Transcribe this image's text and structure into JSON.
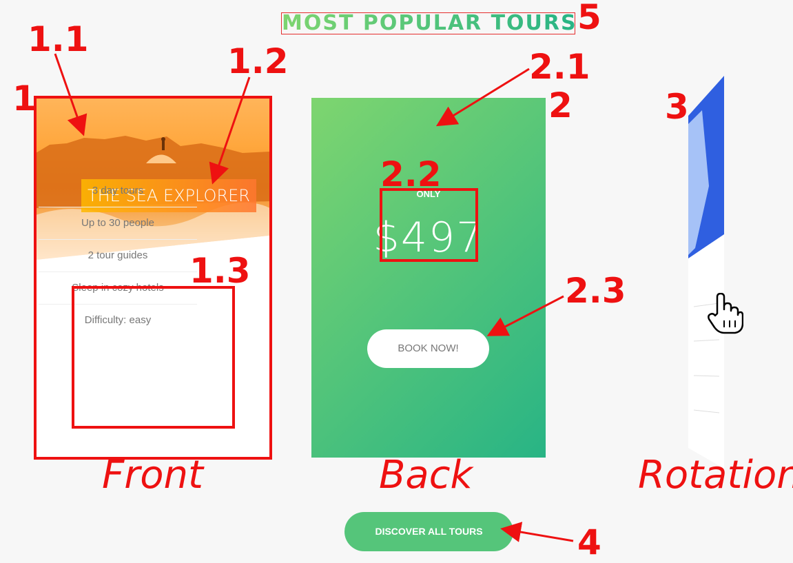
{
  "section_title": "MOST POPULAR TOURS",
  "annotations": {
    "n1": "1",
    "n1_1": "1.1",
    "n1_2": "1.2",
    "n1_3": "1.3",
    "n2": "2",
    "n2_1": "2.1",
    "n2_2": "2.2",
    "n2_3": "2.3",
    "n3": "3",
    "n4": "4",
    "n5": "5"
  },
  "captions": {
    "front": "Front",
    "back": "Back",
    "rotation": "Rotation"
  },
  "front_card": {
    "heading": "THE SEA EXPLORER",
    "details": [
      "3 day tours",
      "Up to 30 people",
      "2 tour guides",
      "Sleep in cozy hotels",
      "Difficulty: easy"
    ]
  },
  "back_card": {
    "price_label": "ONLY",
    "price": "$497",
    "button_label": "BOOK NOW!"
  },
  "cta_button": "DISCOVER ALL TOURS",
  "colors": {
    "gradient_start": "#7ed56f",
    "gradient_end": "#28b485",
    "annotation": "#ee1111",
    "heading_start": "#ffb900",
    "heading_end": "#ff7730"
  },
  "icons": {
    "cursor": "hand-pointer-icon"
  }
}
